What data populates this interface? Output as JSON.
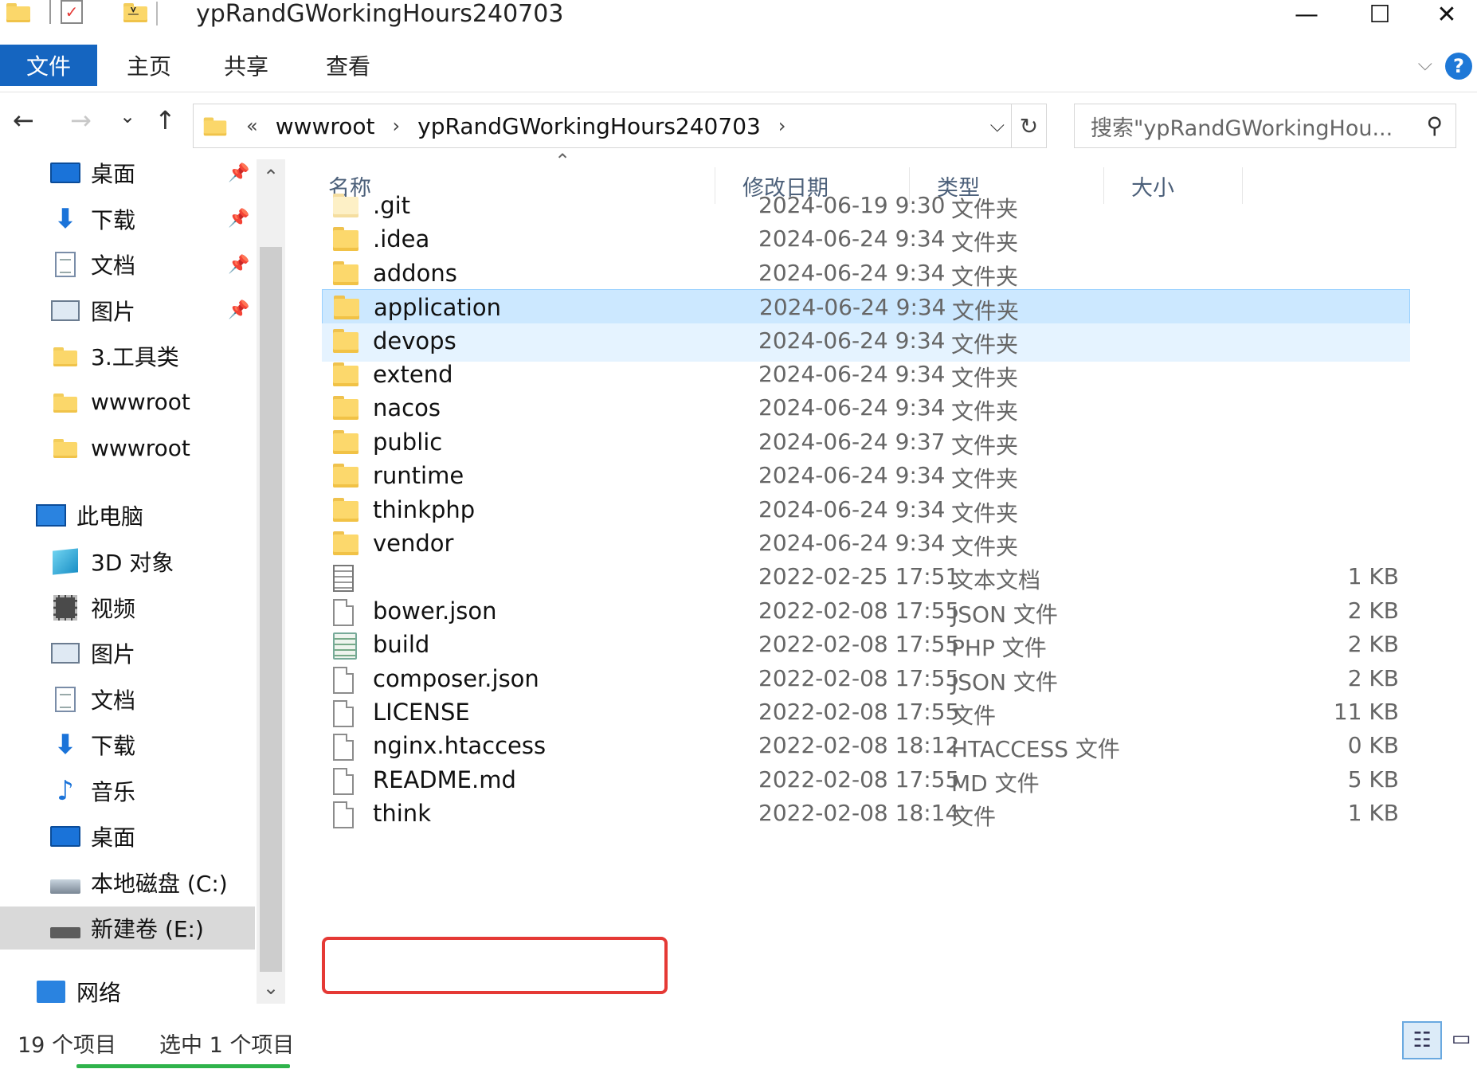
{
  "window": {
    "title": "ypRandGWorkingHours240703",
    "minimize": "—",
    "maximize": "☐",
    "close": "✕",
    "qa_dropdown": "⩡"
  },
  "ribbon": {
    "tabs": [
      "文件",
      "主页",
      "共享",
      "查看"
    ],
    "help": "?",
    "collapse": "⌵"
  },
  "nav": {
    "back": "←",
    "forward": "→",
    "recent": "⌄",
    "up": "↑"
  },
  "address": {
    "overflow": "«",
    "crumbs": [
      "wwwroot",
      "ypRandGWorkingHours240703"
    ],
    "sep": "›",
    "dropdown": "⌵",
    "refresh": "↻"
  },
  "search": {
    "placeholder": "搜索\"ypRandGWorkingHou...",
    "icon": "⚲"
  },
  "navpane": {
    "quick_access": [
      {
        "label": "桌面",
        "icon": "desktop-icon",
        "pinned": true
      },
      {
        "label": "下载",
        "icon": "download-icon",
        "pinned": true
      },
      {
        "label": "文档",
        "icon": "document-icon",
        "pinned": true
      },
      {
        "label": "图片",
        "icon": "pictures-icon",
        "pinned": true
      },
      {
        "label": "3.工具类",
        "icon": "folder-icon",
        "pinned": false
      },
      {
        "label": "wwwroot",
        "icon": "folder-icon",
        "pinned": false
      },
      {
        "label": "wwwroot",
        "icon": "folder-icon",
        "pinned": false
      }
    ],
    "this_pc": "此电脑",
    "pc_items": [
      {
        "label": "3D 对象",
        "icon": "3d-objects-icon"
      },
      {
        "label": "视频",
        "icon": "videos-icon"
      },
      {
        "label": "图片",
        "icon": "pictures-icon"
      },
      {
        "label": "文档",
        "icon": "document-icon"
      },
      {
        "label": "下载",
        "icon": "download-icon"
      },
      {
        "label": "音乐",
        "icon": "music-icon"
      },
      {
        "label": "桌面",
        "icon": "desktop-icon"
      },
      {
        "label": "本地磁盘 (C:)",
        "icon": "local-disk-icon"
      },
      {
        "label": "新建卷 (E:)",
        "icon": "drive-icon"
      }
    ],
    "network": "网络",
    "pin_glyph": "📌",
    "scroll_up": "⌃",
    "scroll_down": "⌄"
  },
  "filelist": {
    "sort_arrow": "⌃",
    "columns": {
      "name": "名称",
      "date": "修改日期",
      "type": "类型",
      "size": "大小"
    },
    "rows": [
      {
        "name": ".git",
        "date": "2024-06-19 9:30",
        "type": "文件夹",
        "size": "",
        "icon": "folder-faded"
      },
      {
        "name": ".idea",
        "date": "2024-06-24 9:34",
        "type": "文件夹",
        "size": "",
        "icon": "folder"
      },
      {
        "name": "addons",
        "date": "2024-06-24 9:34",
        "type": "文件夹",
        "size": "",
        "icon": "folder"
      },
      {
        "name": "application",
        "date": "2024-06-24 9:34",
        "type": "文件夹",
        "size": "",
        "icon": "folder",
        "state": "selected"
      },
      {
        "name": "devops",
        "date": "2024-06-24 9:34",
        "type": "文件夹",
        "size": "",
        "icon": "folder",
        "state": "hover"
      },
      {
        "name": "extend",
        "date": "2024-06-24 9:34",
        "type": "文件夹",
        "size": "",
        "icon": "folder"
      },
      {
        "name": "nacos",
        "date": "2024-06-24 9:34",
        "type": "文件夹",
        "size": "",
        "icon": "folder"
      },
      {
        "name": "public",
        "date": "2024-06-24 9:37",
        "type": "文件夹",
        "size": "",
        "icon": "folder"
      },
      {
        "name": "runtime",
        "date": "2024-06-24 9:34",
        "type": "文件夹",
        "size": "",
        "icon": "folder"
      },
      {
        "name": "thinkphp",
        "date": "2024-06-24 9:34",
        "type": "文件夹",
        "size": "",
        "icon": "folder"
      },
      {
        "name": "vendor",
        "date": "2024-06-24 9:34",
        "type": "文件夹",
        "size": "",
        "icon": "folder"
      },
      {
        "name": "",
        "date": "2022-02-25 17:51",
        "type": "文本文档",
        "size": "1 KB",
        "icon": "text"
      },
      {
        "name": "bower.json",
        "date": "2022-02-08 17:55",
        "type": "JSON 文件",
        "size": "2 KB",
        "icon": "file"
      },
      {
        "name": "build",
        "date": "2022-02-08 17:55",
        "type": "PHP 文件",
        "size": "2 KB",
        "icon": "php"
      },
      {
        "name": "composer.json",
        "date": "2022-02-08 17:55",
        "type": "JSON 文件",
        "size": "2 KB",
        "icon": "file"
      },
      {
        "name": "LICENSE",
        "date": "2022-02-08 17:55",
        "type": "文件",
        "size": "11 KB",
        "icon": "file"
      },
      {
        "name": "nginx.htaccess",
        "date": "2022-02-08 18:12",
        "type": "HTACCESS 文件",
        "size": "0 KB",
        "icon": "file"
      },
      {
        "name": "README.md",
        "date": "2022-02-08 17:55",
        "type": "MD 文件",
        "size": "5 KB",
        "icon": "file"
      },
      {
        "name": "think",
        "date": "2022-02-08 18:14",
        "type": "文件",
        "size": "1 KB",
        "icon": "file"
      }
    ]
  },
  "status": {
    "count": "19 个项目",
    "selected": "选中 1 个项目",
    "view_details": "☷",
    "view_large": "▭"
  }
}
